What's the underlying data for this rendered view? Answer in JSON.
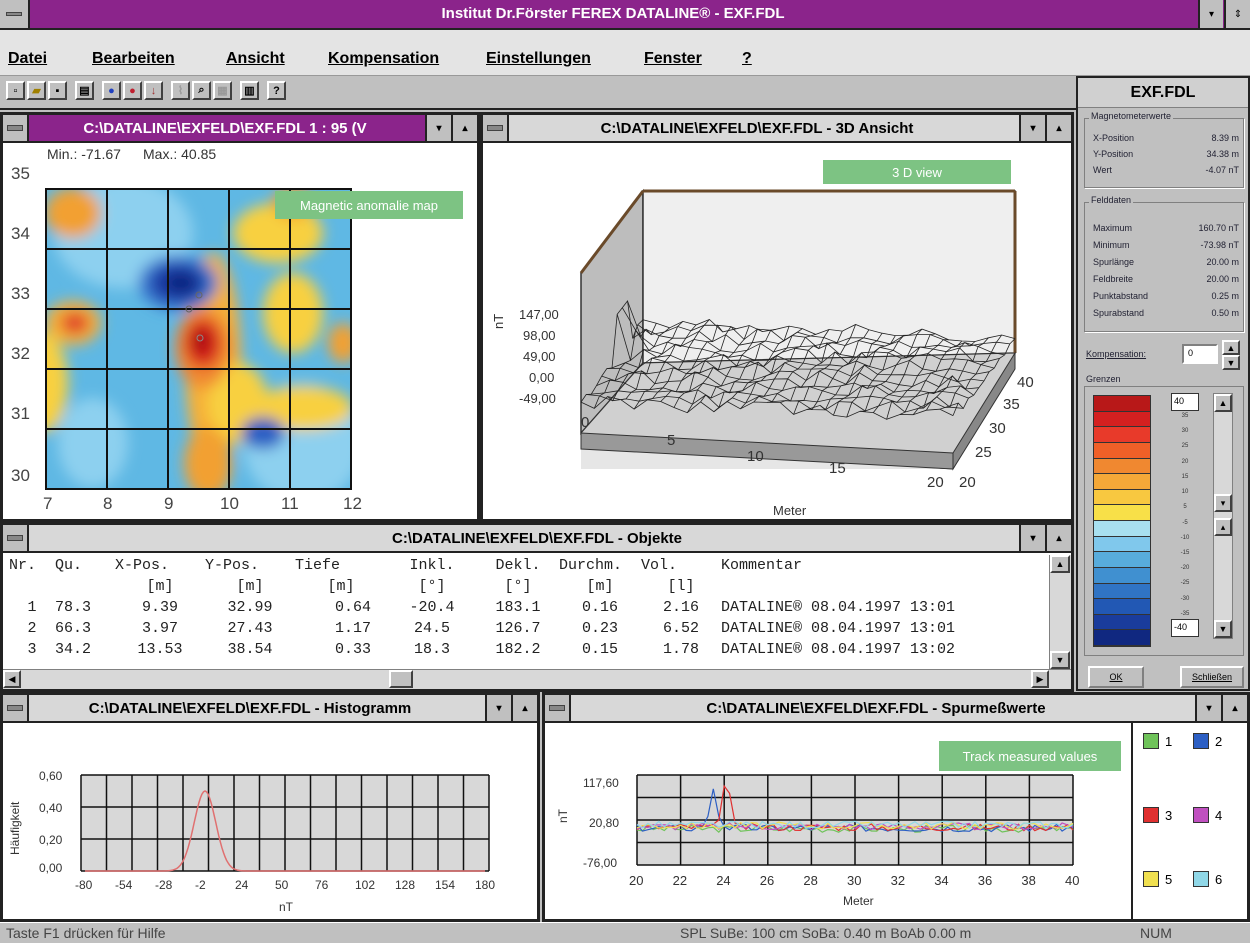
{
  "app": {
    "title": "Institut Dr.Förster FEREX DATALINE® - EXF.FDL",
    "menu": [
      "Datei",
      "Bearbeiten",
      "Ansicht",
      "Kompensation",
      "Einstellungen",
      "Fenster",
      "?"
    ]
  },
  "map_window": {
    "title": "C:\\DATALINE\\EXFELD\\EXF.FDL 1 : 95 (V",
    "min_label": "Min.: -71.67",
    "max_label": "Max.: 40.85",
    "y_ticks": [
      "35",
      "34",
      "33",
      "32",
      "31",
      "30"
    ],
    "x_ticks": [
      "7",
      "8",
      "9",
      "10",
      "11",
      "12"
    ],
    "annotation": "Magnetic anomalie map"
  },
  "view3d_window": {
    "title": "C:\\DATALINE\\EXFELD\\EXF.FDL - 3D Ansicht",
    "annotation": "3 D view",
    "z_ticks": [
      "147,00",
      "98,00",
      "49,00",
      "0,00",
      "-49,00"
    ],
    "z_unit": "nT",
    "x_ticks": [
      "0",
      "5",
      "10",
      "15",
      "20"
    ],
    "y_ticks": [
      "20",
      "25",
      "30",
      "35",
      "40"
    ],
    "x_label": "Meter"
  },
  "objects_window": {
    "title": "C:\\DATALINE\\EXFELD\\EXF.FDL - Objekte",
    "headers": [
      "Nr.",
      "Qu.",
      "X-Pos.",
      "Y-Pos.",
      "Tiefe",
      "Inkl.",
      "Dekl.",
      "Durchm.",
      "Vol.",
      "Kommentar"
    ],
    "units": [
      "",
      "",
      "[m]",
      "[m]",
      "[m]",
      "[°]",
      "[°]",
      "[m]",
      "[l]",
      ""
    ],
    "rows": [
      [
        "1",
        "78.3",
        "9.39",
        "32.99",
        "0.64",
        "-20.4",
        "183.1",
        "0.16",
        "2.16",
        "DATALINE® 08.04.1997 13:01"
      ],
      [
        "2",
        "66.3",
        "3.97",
        "27.43",
        "1.17",
        "24.5",
        "126.7",
        "0.23",
        "6.52",
        "DATALINE® 08.04.1997 13:01"
      ],
      [
        "3",
        "34.2",
        "13.53",
        "38.54",
        "0.33",
        "18.3",
        "182.2",
        "0.15",
        "1.78",
        "DATALINE® 08.04.1997 13:02"
      ]
    ]
  },
  "histogram_window": {
    "title": "C:\\DATALINE\\EXFELD\\EXF.FDL - Histogramm",
    "y_label": "Häufigkeit",
    "y_ticks": [
      "0,60",
      "0,40",
      "0,20",
      "0,00"
    ],
    "x_ticks": [
      "-80",
      "-54",
      "-28",
      "-2",
      "24",
      "50",
      "76",
      "102",
      "128",
      "154",
      "180"
    ],
    "x_label": "nT"
  },
  "track_window": {
    "title": "C:\\DATALINE\\EXFELD\\EXF.FDL - Spurmeßwerte",
    "annotation": "Track measured values",
    "y_unit": "nT",
    "y_ticks": [
      "117,60",
      "20,80",
      "-76,00"
    ],
    "x_ticks": [
      "20",
      "22",
      "24",
      "26",
      "28",
      "30",
      "32",
      "34",
      "36",
      "38",
      "40"
    ],
    "x_label": "Meter",
    "legend": [
      {
        "label": "1",
        "color": "#6fc35a"
      },
      {
        "label": "2",
        "color": "#2c5fc4"
      },
      {
        "label": "3",
        "color": "#e03030"
      },
      {
        "label": "4",
        "color": "#c050c0"
      },
      {
        "label": "5",
        "color": "#f0e050"
      },
      {
        "label": "6",
        "color": "#90d8e8"
      }
    ]
  },
  "side_panel": {
    "title": "EXF.FDL",
    "section1": "Magnetometerwerte",
    "rows1": [
      {
        "label": "X-Position",
        "value": "8.39 m"
      },
      {
        "label": "Y-Position",
        "value": "34.38 m"
      },
      {
        "label": "Wert",
        "value": "-4.07 nT"
      }
    ],
    "section2": "Felddaten",
    "rows2": [
      {
        "label": "Maximum",
        "value": "160.70 nT"
      },
      {
        "label": "Minimum",
        "value": "-73.98 nT"
      },
      {
        "label": "Spurlänge",
        "value": "20.00 m"
      },
      {
        "label": "Feldbreite",
        "value": "20.00 m"
      },
      {
        "label": "Punktabstand",
        "value": "0.25 m"
      },
      {
        "label": "Spurabstand",
        "value": "0.50 m"
      }
    ],
    "kompensation_label": "Kompensation:",
    "kompensation_value": "0",
    "grenzen_label": "Grenzen",
    "grenze_top": "40",
    "grenze_bottom": "-40",
    "scale_ticks": [
      "35",
      "30",
      "25",
      "20",
      "15",
      "10",
      "5",
      "-5",
      "-10",
      "-15",
      "-20",
      "-25",
      "-30",
      "-35"
    ],
    "palette": [
      "#b81818",
      "#d42020",
      "#e83a2a",
      "#f06028",
      "#f08830",
      "#f4a838",
      "#f8c840",
      "#f8e048",
      "#a8e0f0",
      "#80c8ec",
      "#58acdc",
      "#4090d0",
      "#3074c4",
      "#2258b4",
      "#1a3c9c",
      "#102880"
    ],
    "ok_label": "OK",
    "close_label": "Schließen"
  },
  "status": {
    "help": "Taste F1 drücken für Hilfe",
    "info": "SPL SuBe: 100 cm SoBa: 0.40 m BoAb 0.00 m",
    "num": "NUM"
  }
}
